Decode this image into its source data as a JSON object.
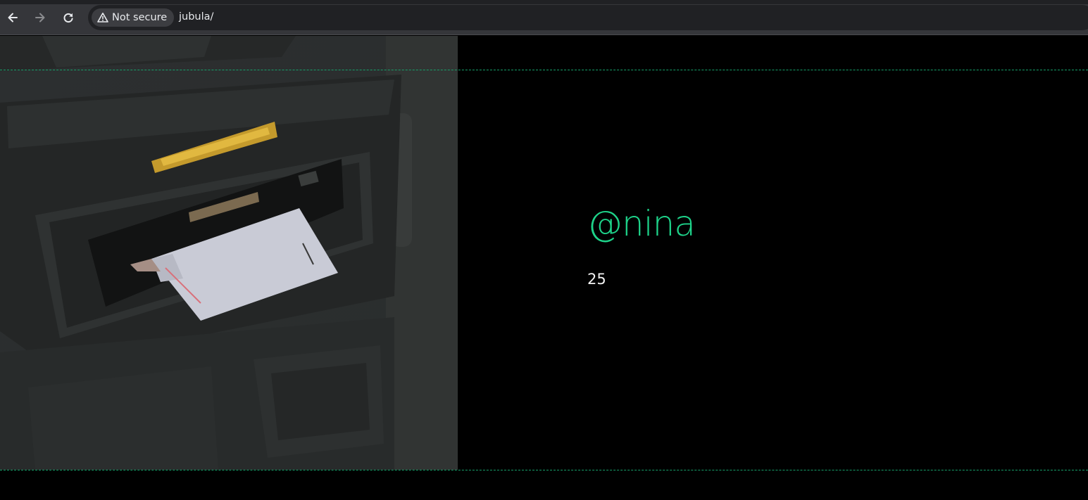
{
  "browser": {
    "security_label": "Not secure",
    "url": "jubula/",
    "icons": {
      "back": "arrow-left-icon",
      "forward": "arrow-right-icon",
      "reload": "reload-icon",
      "warning": "warning-triangle-icon"
    }
  },
  "profile": {
    "handle": "@nina",
    "count": "25"
  },
  "theme": {
    "accent": "#1ed38a",
    "background": "#000000",
    "chrome": "#35363a"
  }
}
